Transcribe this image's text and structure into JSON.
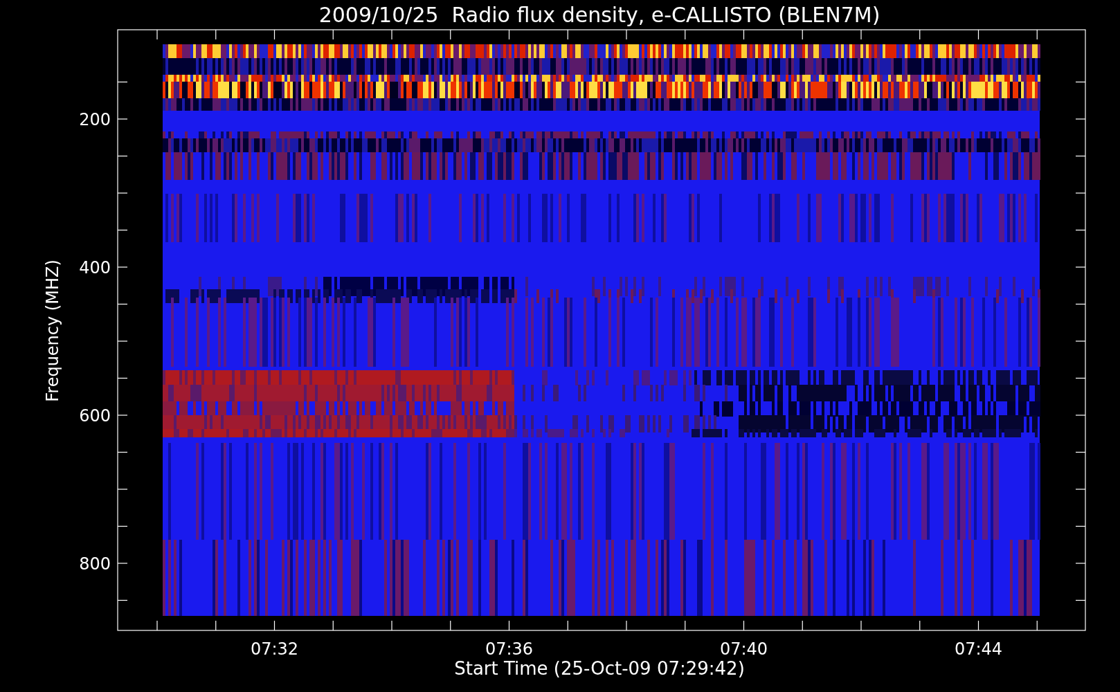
{
  "title": "2009/10/25  Radio flux density, e-CALLISTO (BLEN7M)",
  "plot": {
    "ylabel": "Frequency (MHZ)",
    "xlabel": "Start Time (25-Oct-09 07:29:42)",
    "y_tick_labels": [
      "200",
      "400",
      "600",
      "800"
    ],
    "x_tick_labels": [
      "07:32",
      "07:36",
      "07:40",
      "07:44"
    ]
  }
}
